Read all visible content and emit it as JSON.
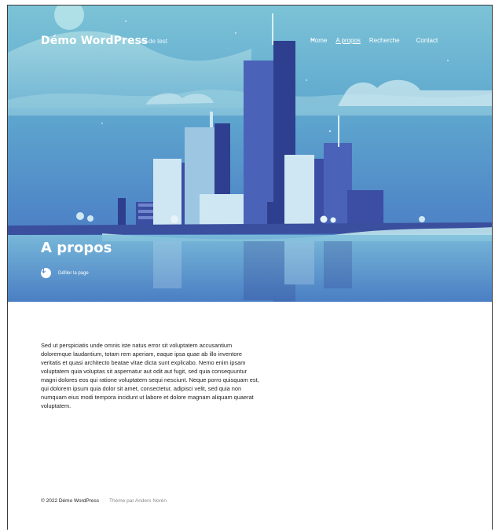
{
  "site": {
    "title": "Démo WordPress",
    "description": "Site de test"
  },
  "nav": {
    "items": [
      {
        "label": "Home"
      },
      {
        "label": "A propos"
      },
      {
        "label": "Recherche"
      },
      {
        "label": "Contact"
      }
    ]
  },
  "hero": {
    "page_title": "A propos",
    "scroll_label": "Défiler la page"
  },
  "content": {
    "paragraph": "Sed ut perspiciatis unde omnis iste natus error sit voluptatem accusantium doloremque laudantium, totam rem aperiam, eaque ipsa quae ab illo inventore veritatis et quasi architecto beatae vitae dicta sunt explicabo. Nemo enim ipsam voluptatem quia voluptas sit aspernatur aut odit aut fugit, sed quia consequuntur magni dolores eos qui ratione voluptatem sequi nesciunt. Neque porro quisquam est, qui dolorem ipsum quia dolor sit amet, consectetur, adipisci velit, sed quia non numquam eius modi tempora incidunt ut labore et dolore magnam aliquam quaerat voluptatem."
  },
  "footer": {
    "copyright": "© 2022 Démo WordPress",
    "credit": "Thème par Anders Norén"
  },
  "icons": {
    "nav_dropdown": "chevron-down-icon",
    "scroll": "arrow-down-icon"
  },
  "colors": {
    "hero_top": "#7cc3d6",
    "hero_bottom": "#4a78c0",
    "building_dark": "#2f3f8f",
    "building_light": "#cfe7f2"
  }
}
